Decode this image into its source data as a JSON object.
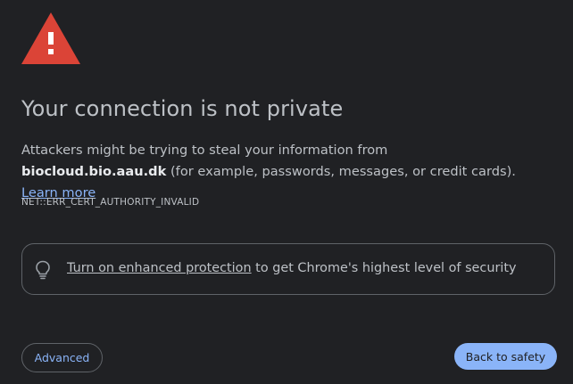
{
  "warning": {
    "icon": "warning-triangle-icon",
    "icon_color": "#db4437",
    "mark": "!"
  },
  "title": "Your connection is not private",
  "message": {
    "prefix": "Attackers might be trying to steal your information from ",
    "host": "biocloud.bio.aau.dk",
    "suffix": " (for example, passwords, messages, or credit cards). ",
    "learn_more": "Learn more"
  },
  "error_code": "NET::ERR_CERT_AUTHORITY_INVALID",
  "enhanced_protection": {
    "icon": "lightbulb-icon",
    "link_text": "Turn on enhanced protection",
    "rest_text": " to get Chrome's highest level of security"
  },
  "buttons": {
    "advanced": "Advanced",
    "back": "Back to safety"
  },
  "colors": {
    "background": "#202124",
    "text": "#bdc1c6",
    "accent": "#8ab4f8",
    "border": "#5f6368"
  }
}
